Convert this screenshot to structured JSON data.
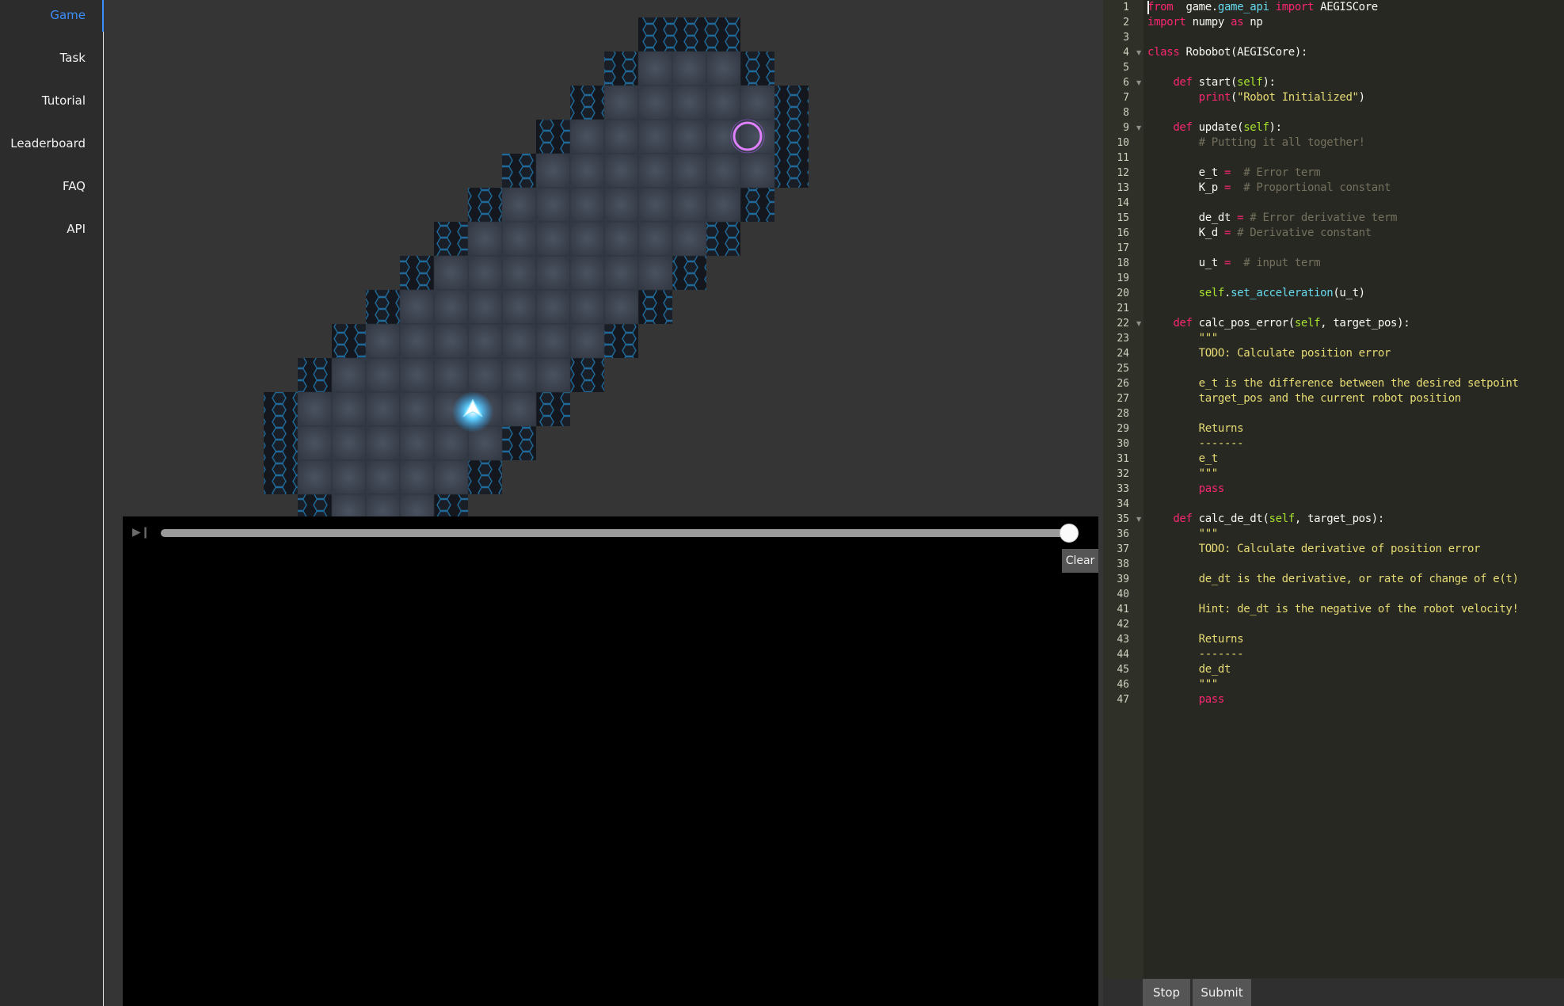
{
  "nav": {
    "items": [
      {
        "label": "Game",
        "active": true
      },
      {
        "label": "Task",
        "active": false
      },
      {
        "label": "Tutorial",
        "active": false
      },
      {
        "label": "Leaderboard",
        "active": false
      },
      {
        "label": "FAQ",
        "active": false
      },
      {
        "label": "API",
        "active": false
      }
    ],
    "active_color": "#3c8fff"
  },
  "game": {
    "background": "#353535",
    "robot_glow": "#2ea8ff",
    "target_color": "#e080ff",
    "tile_color": "#3a4250",
    "hex_border": "#1f6a9a"
  },
  "console": {
    "clear_label": "Clear",
    "play_icon": "play-step-icon",
    "timeline_progress": 1.0
  },
  "editor": {
    "fold_lines": [
      4,
      6,
      9,
      22,
      35
    ],
    "lines": [
      [
        [
          "kw",
          "from"
        ],
        [
          "",
          "  game."
        ],
        [
          "at",
          "game_api"
        ],
        [
          "",
          ""
        ],
        [
          "kw",
          " import"
        ],
        [
          "",
          " AEGISCore"
        ]
      ],
      [
        [
          "kw",
          "import"
        ],
        [
          "",
          " numpy "
        ],
        [
          "kw",
          "as"
        ],
        [
          "",
          " np"
        ]
      ],
      [],
      [
        [
          "kw",
          "class"
        ],
        [
          "",
          " Robobot(AEGISCore):"
        ]
      ],
      [],
      [
        [
          "",
          "    "
        ],
        [
          "kw",
          "def"
        ],
        [
          "",
          " start("
        ],
        [
          "self",
          "self"
        ],
        [
          "",
          "):"
        ]
      ],
      [
        [
          "",
          "        "
        ],
        [
          "kw",
          "print"
        ],
        [
          "",
          "("
        ],
        [
          "str",
          "\"Robot Initialized\""
        ],
        [
          "",
          ")"
        ]
      ],
      [],
      [
        [
          "",
          "    "
        ],
        [
          "kw",
          "def"
        ],
        [
          "",
          " update("
        ],
        [
          "self",
          "self"
        ],
        [
          "",
          "):"
        ]
      ],
      [
        [
          "",
          "        "
        ],
        [
          "cm",
          "# Putting it all together!"
        ]
      ],
      [],
      [
        [
          "",
          "        e_t "
        ],
        [
          "kw",
          "="
        ],
        [
          "",
          "  "
        ],
        [
          "cm",
          "# Error term"
        ]
      ],
      [
        [
          "",
          "        K_p "
        ],
        [
          "kw",
          "="
        ],
        [
          "",
          "  "
        ],
        [
          "cm",
          "# Proportional constant"
        ]
      ],
      [],
      [
        [
          "",
          "        de_dt "
        ],
        [
          "kw",
          "="
        ],
        [
          "",
          " "
        ],
        [
          "cm",
          "# Error derivative term"
        ]
      ],
      [
        [
          "",
          "        K_d "
        ],
        [
          "kw",
          "="
        ],
        [
          "",
          " "
        ],
        [
          "cm",
          "# Derivative constant"
        ]
      ],
      [],
      [
        [
          "",
          "        u_t "
        ],
        [
          "kw",
          "="
        ],
        [
          "",
          "  "
        ],
        [
          "cm",
          "# input term"
        ]
      ],
      [],
      [
        [
          "",
          "        "
        ],
        [
          "self",
          "self"
        ],
        [
          "",
          "."
        ],
        [
          "at",
          "set_acceleration"
        ],
        [
          "",
          "(u_t)"
        ]
      ],
      [],
      [
        [
          "",
          "    "
        ],
        [
          "kw",
          "def"
        ],
        [
          "",
          " calc_pos_error("
        ],
        [
          "self",
          "self"
        ],
        [
          "",
          ", target_pos):"
        ]
      ],
      [
        [
          "",
          "        "
        ],
        [
          "str",
          "\"\"\""
        ]
      ],
      [
        [
          "",
          "        "
        ],
        [
          "str",
          "TODO: Calculate position error"
        ]
      ],
      [],
      [
        [
          "",
          "        "
        ],
        [
          "str",
          "e_t is the difference between the desired setpoint"
        ]
      ],
      [
        [
          "",
          "        "
        ],
        [
          "str",
          "target_pos and the current robot position"
        ]
      ],
      [],
      [
        [
          "",
          "        "
        ],
        [
          "str",
          "Returns"
        ]
      ],
      [
        [
          "",
          "        "
        ],
        [
          "str",
          "-------"
        ]
      ],
      [
        [
          "",
          "        "
        ],
        [
          "str",
          "e_t"
        ]
      ],
      [
        [
          "",
          "        "
        ],
        [
          "str",
          "\"\"\""
        ]
      ],
      [
        [
          "",
          "        "
        ],
        [
          "kw",
          "pass"
        ]
      ],
      [],
      [
        [
          "",
          "    "
        ],
        [
          "kw",
          "def"
        ],
        [
          "",
          " calc_de_dt("
        ],
        [
          "self",
          "self"
        ],
        [
          "",
          ", target_pos):"
        ]
      ],
      [
        [
          "",
          "        "
        ],
        [
          "str",
          "\"\"\""
        ]
      ],
      [
        [
          "",
          "        "
        ],
        [
          "str",
          "TODO: Calculate derivative of position error"
        ]
      ],
      [],
      [
        [
          "",
          "        "
        ],
        [
          "str",
          "de_dt is the derivative, or rate of change of e(t)"
        ]
      ],
      [],
      [
        [
          "",
          "        "
        ],
        [
          "str",
          "Hint: de_dt is the negative of the robot velocity!"
        ]
      ],
      [],
      [
        [
          "",
          "        "
        ],
        [
          "str",
          "Returns"
        ]
      ],
      [
        [
          "",
          "        "
        ],
        [
          "str",
          "-------"
        ]
      ],
      [
        [
          "",
          "        "
        ],
        [
          "str",
          "de_dt"
        ]
      ],
      [
        [
          "",
          "        "
        ],
        [
          "str",
          "\"\"\""
        ]
      ],
      [
        [
          "",
          "        "
        ],
        [
          "kw",
          "pass"
        ]
      ]
    ]
  },
  "actions": {
    "stop_label": "Stop",
    "submit_label": "Submit"
  }
}
